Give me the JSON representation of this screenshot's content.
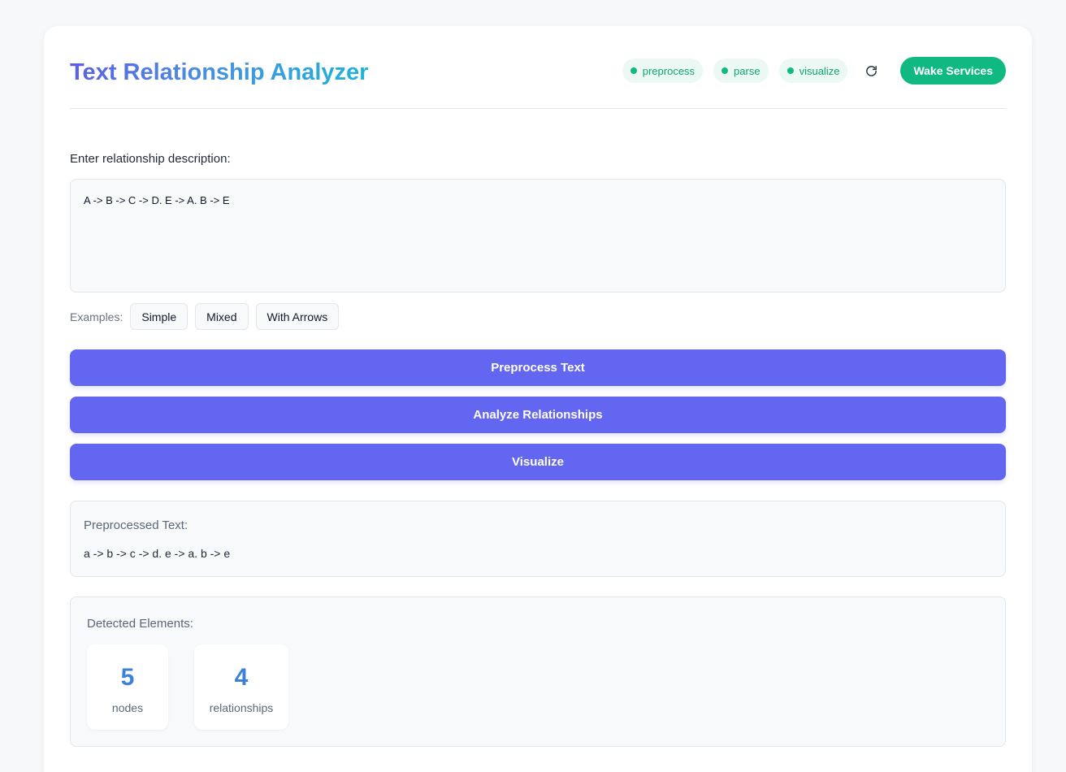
{
  "header": {
    "title": "Text Relationship Analyzer",
    "services": [
      {
        "label": "preprocess",
        "status_color": "#10b981"
      },
      {
        "label": "parse",
        "status_color": "#10b981"
      },
      {
        "label": "visualize",
        "status_color": "#10b981"
      }
    ],
    "refresh_icon": "refresh-icon",
    "wake_label": "Wake Services"
  },
  "input": {
    "label": "Enter relationship description:",
    "value": "A -> B -> C -> D. E -> A. B -> E"
  },
  "examples": {
    "label": "Examples:",
    "items": [
      "Simple",
      "Mixed",
      "With Arrows"
    ]
  },
  "actions": {
    "preprocess_label": "Preprocess Text",
    "analyze_label": "Analyze Relationships",
    "visualize_label": "Visualize"
  },
  "preprocessed": {
    "title": "Preprocessed Text:",
    "text": "a -> b -> c -> d. e -> a. b -> e"
  },
  "detected": {
    "title": "Detected Elements:",
    "stats": [
      {
        "value": "5",
        "label": "nodes"
      },
      {
        "value": "4",
        "label": "relationships"
      }
    ]
  },
  "colors": {
    "accent": "#6366f1",
    "success": "#10b981",
    "stat_value": "#3b82d6"
  }
}
